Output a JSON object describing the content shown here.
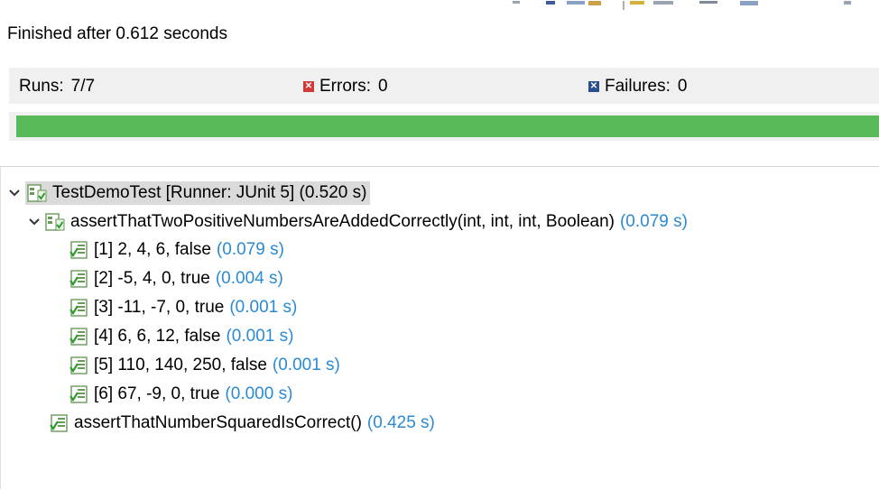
{
  "status_text": "Finished after 0.612 seconds",
  "counters": {
    "runs_label": "Runs:",
    "runs_value": "7/7",
    "errors_label": "Errors:",
    "errors_value": "0",
    "failures_label": "Failures:",
    "failures_value": "0"
  },
  "progress": {
    "fraction": 1.0,
    "color": "#58b95a"
  },
  "tree": {
    "root": {
      "label": "TestDemoTest [Runner: JUnit 5] (0.520 s)",
      "icon": "test-suite-success-icon"
    },
    "suite": {
      "label": "assertThatTwoPositiveNumbersAreAddedCorrectly(int, int, int, Boolean)",
      "time": "(0.079 s)",
      "icon": "test-suite-success-icon"
    },
    "cases": [
      {
        "label": "[1] 2, 4, 6, false",
        "time": "(0.079 s)"
      },
      {
        "label": "[2] -5, 4, 0, true",
        "time": "(0.004 s)"
      },
      {
        "label": "[3] -11, -7, 0, true",
        "time": "(0.001 s)"
      },
      {
        "label": "[4] 6, 6, 12, false",
        "time": "(0.001 s)"
      },
      {
        "label": "[5] 110, 140, 250, false",
        "time": "(0.001 s)"
      },
      {
        "label": "[6] 67, -9, 0, true",
        "time": "(0.000 s)"
      }
    ],
    "other": {
      "label": "assertThatNumberSquaredIsCorrect()",
      "time": "(0.425 s)",
      "icon": "test-case-success-icon"
    }
  },
  "colors": {
    "time_text": "#2a8ad4",
    "success_green": "#58b95a"
  }
}
